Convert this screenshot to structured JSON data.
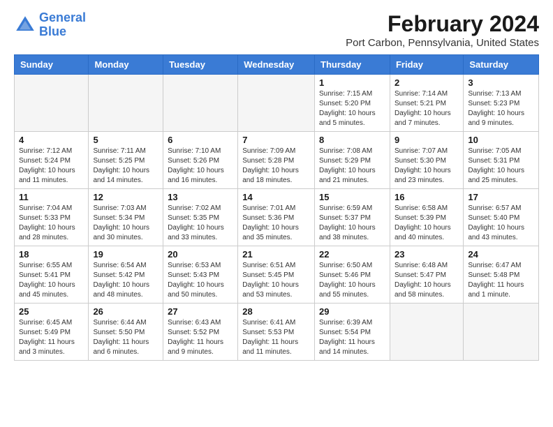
{
  "logo": {
    "line1": "General",
    "line2": "Blue"
  },
  "title": "February 2024",
  "location": "Port Carbon, Pennsylvania, United States",
  "days_of_week": [
    "Sunday",
    "Monday",
    "Tuesday",
    "Wednesday",
    "Thursday",
    "Friday",
    "Saturday"
  ],
  "weeks": [
    [
      {
        "num": "",
        "info": ""
      },
      {
        "num": "",
        "info": ""
      },
      {
        "num": "",
        "info": ""
      },
      {
        "num": "",
        "info": ""
      },
      {
        "num": "1",
        "info": "Sunrise: 7:15 AM\nSunset: 5:20 PM\nDaylight: 10 hours\nand 5 minutes."
      },
      {
        "num": "2",
        "info": "Sunrise: 7:14 AM\nSunset: 5:21 PM\nDaylight: 10 hours\nand 7 minutes."
      },
      {
        "num": "3",
        "info": "Sunrise: 7:13 AM\nSunset: 5:23 PM\nDaylight: 10 hours\nand 9 minutes."
      }
    ],
    [
      {
        "num": "4",
        "info": "Sunrise: 7:12 AM\nSunset: 5:24 PM\nDaylight: 10 hours\nand 11 minutes."
      },
      {
        "num": "5",
        "info": "Sunrise: 7:11 AM\nSunset: 5:25 PM\nDaylight: 10 hours\nand 14 minutes."
      },
      {
        "num": "6",
        "info": "Sunrise: 7:10 AM\nSunset: 5:26 PM\nDaylight: 10 hours\nand 16 minutes."
      },
      {
        "num": "7",
        "info": "Sunrise: 7:09 AM\nSunset: 5:28 PM\nDaylight: 10 hours\nand 18 minutes."
      },
      {
        "num": "8",
        "info": "Sunrise: 7:08 AM\nSunset: 5:29 PM\nDaylight: 10 hours\nand 21 minutes."
      },
      {
        "num": "9",
        "info": "Sunrise: 7:07 AM\nSunset: 5:30 PM\nDaylight: 10 hours\nand 23 minutes."
      },
      {
        "num": "10",
        "info": "Sunrise: 7:05 AM\nSunset: 5:31 PM\nDaylight: 10 hours\nand 25 minutes."
      }
    ],
    [
      {
        "num": "11",
        "info": "Sunrise: 7:04 AM\nSunset: 5:33 PM\nDaylight: 10 hours\nand 28 minutes."
      },
      {
        "num": "12",
        "info": "Sunrise: 7:03 AM\nSunset: 5:34 PM\nDaylight: 10 hours\nand 30 minutes."
      },
      {
        "num": "13",
        "info": "Sunrise: 7:02 AM\nSunset: 5:35 PM\nDaylight: 10 hours\nand 33 minutes."
      },
      {
        "num": "14",
        "info": "Sunrise: 7:01 AM\nSunset: 5:36 PM\nDaylight: 10 hours\nand 35 minutes."
      },
      {
        "num": "15",
        "info": "Sunrise: 6:59 AM\nSunset: 5:37 PM\nDaylight: 10 hours\nand 38 minutes."
      },
      {
        "num": "16",
        "info": "Sunrise: 6:58 AM\nSunset: 5:39 PM\nDaylight: 10 hours\nand 40 minutes."
      },
      {
        "num": "17",
        "info": "Sunrise: 6:57 AM\nSunset: 5:40 PM\nDaylight: 10 hours\nand 43 minutes."
      }
    ],
    [
      {
        "num": "18",
        "info": "Sunrise: 6:55 AM\nSunset: 5:41 PM\nDaylight: 10 hours\nand 45 minutes."
      },
      {
        "num": "19",
        "info": "Sunrise: 6:54 AM\nSunset: 5:42 PM\nDaylight: 10 hours\nand 48 minutes."
      },
      {
        "num": "20",
        "info": "Sunrise: 6:53 AM\nSunset: 5:43 PM\nDaylight: 10 hours\nand 50 minutes."
      },
      {
        "num": "21",
        "info": "Sunrise: 6:51 AM\nSunset: 5:45 PM\nDaylight: 10 hours\nand 53 minutes."
      },
      {
        "num": "22",
        "info": "Sunrise: 6:50 AM\nSunset: 5:46 PM\nDaylight: 10 hours\nand 55 minutes."
      },
      {
        "num": "23",
        "info": "Sunrise: 6:48 AM\nSunset: 5:47 PM\nDaylight: 10 hours\nand 58 minutes."
      },
      {
        "num": "24",
        "info": "Sunrise: 6:47 AM\nSunset: 5:48 PM\nDaylight: 11 hours\nand 1 minute."
      }
    ],
    [
      {
        "num": "25",
        "info": "Sunrise: 6:45 AM\nSunset: 5:49 PM\nDaylight: 11 hours\nand 3 minutes."
      },
      {
        "num": "26",
        "info": "Sunrise: 6:44 AM\nSunset: 5:50 PM\nDaylight: 11 hours\nand 6 minutes."
      },
      {
        "num": "27",
        "info": "Sunrise: 6:43 AM\nSunset: 5:52 PM\nDaylight: 11 hours\nand 9 minutes."
      },
      {
        "num": "28",
        "info": "Sunrise: 6:41 AM\nSunset: 5:53 PM\nDaylight: 11 hours\nand 11 minutes."
      },
      {
        "num": "29",
        "info": "Sunrise: 6:39 AM\nSunset: 5:54 PM\nDaylight: 11 hours\nand 14 minutes."
      },
      {
        "num": "",
        "info": ""
      },
      {
        "num": "",
        "info": ""
      }
    ]
  ]
}
